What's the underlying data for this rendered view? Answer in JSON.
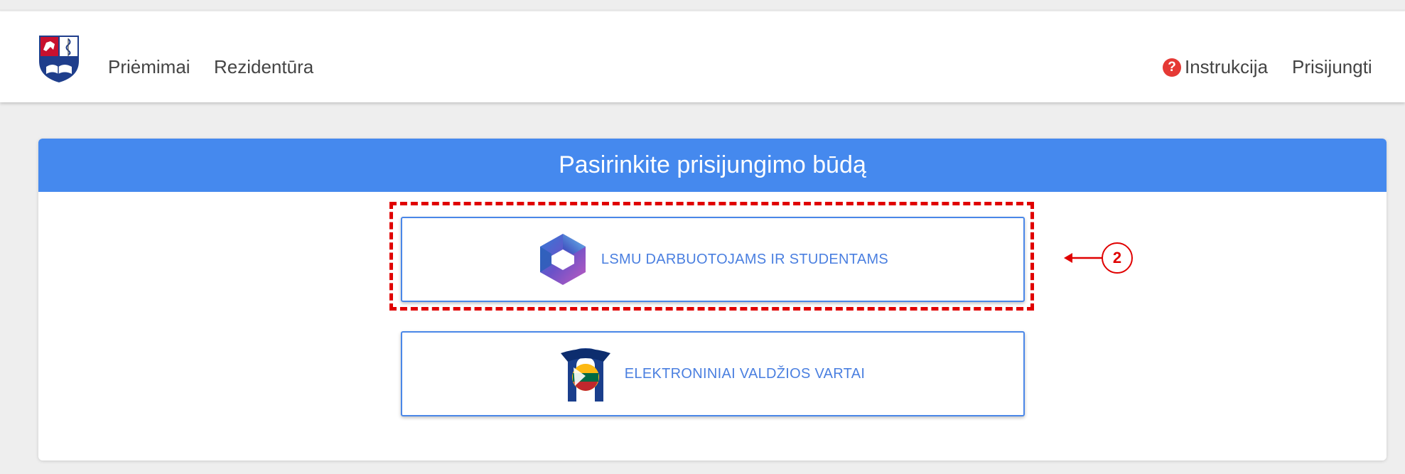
{
  "nav": {
    "links": [
      "Priėmimai",
      "Rezidentūra"
    ],
    "instrukcija": "Instrukcija",
    "help_icon": "?",
    "prisijungti": "Prisijungti"
  },
  "panel": {
    "title": "Pasirinkite prisijungimo būdą",
    "buttons": [
      {
        "label": "LSMU DARBUOTOJAMS IR STUDENTAMS",
        "icon": "microsoft-365-icon"
      },
      {
        "label": "ELEKTRONINIAI VALDŽIOS VARTAI",
        "icon": "epaslaugos-icon"
      }
    ]
  },
  "annotation": {
    "number": "2"
  },
  "colors": {
    "accent": "#4589ee",
    "annotation": "#e00000",
    "help": "#e53935"
  }
}
